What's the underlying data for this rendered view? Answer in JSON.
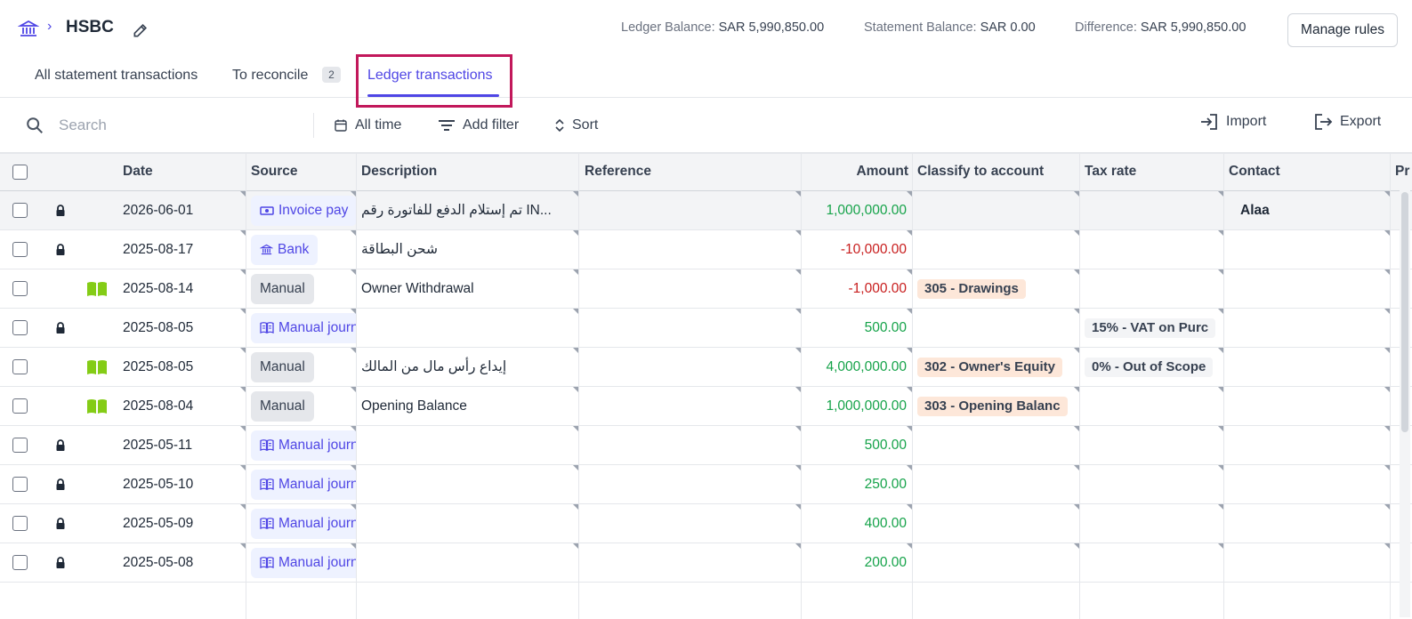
{
  "header": {
    "title": "HSBC",
    "breadcrumb_separator": "›",
    "ledger_balance_label": "Ledger Balance:",
    "ledger_balance_value": "SAR 5,990,850.00",
    "statement_balance_label": "Statement Balance:",
    "statement_balance_value": "SAR 0.00",
    "difference_label": "Difference:",
    "difference_value": "SAR 5,990,850.00",
    "manage_rules_label": "Manage rules"
  },
  "tabs": {
    "all": "All statement transactions",
    "to_reconcile": "To reconcile",
    "to_reconcile_count": "2",
    "ledger": "Ledger transactions",
    "active": "ledger"
  },
  "toolbar": {
    "search_placeholder": "Search",
    "all_time": "All time",
    "add_filter": "Add filter",
    "sort": "Sort",
    "import": "Import",
    "export": "Export"
  },
  "table": {
    "columns": [
      "Date",
      "Source",
      "Description",
      "Reference",
      "Amount",
      "Classify to account",
      "Tax rate",
      "Contact",
      "Pr"
    ],
    "rows": [
      {
        "icon": "lock",
        "date": "2026-06-01",
        "source": "Invoice pay",
        "source_style": "blue",
        "source_icon": "cash",
        "description": "تم إستلام الدفع للفاتورة رقم IN...",
        "reference": "",
        "amount": "1,000,000.00",
        "sign": "pos",
        "account": "",
        "tax": "",
        "contact": "Alaa"
      },
      {
        "icon": "lock",
        "date": "2025-08-17",
        "source": "Bank",
        "source_style": "blue",
        "source_icon": "bank",
        "description": "شحن البطاقة",
        "reference": "",
        "amount": "-10,000.00",
        "sign": "neg",
        "account": "",
        "tax": "",
        "contact": ""
      },
      {
        "icon": "book",
        "date": "2025-08-14",
        "source": "Manual",
        "source_style": "gray",
        "source_icon": "",
        "description": "Owner Withdrawal",
        "reference": "",
        "amount": "-1,000.00",
        "sign": "neg",
        "account": "305 - Drawings",
        "tax": "",
        "contact": ""
      },
      {
        "icon": "lock",
        "date": "2025-08-05",
        "source": "Manual journ",
        "source_style": "blue",
        "source_icon": "journal",
        "description": "",
        "reference": "",
        "amount": "500.00",
        "sign": "pos",
        "account": "",
        "tax": "15% - VAT on Purc",
        "contact": ""
      },
      {
        "icon": "book",
        "date": "2025-08-05",
        "source": "Manual",
        "source_style": "gray",
        "source_icon": "",
        "description": "إيداع رأس مال من المالك",
        "reference": "",
        "amount": "4,000,000.00",
        "sign": "pos",
        "account": "302 - Owner's Equity",
        "tax": "0% - Out of Scope",
        "contact": ""
      },
      {
        "icon": "book",
        "date": "2025-08-04",
        "source": "Manual",
        "source_style": "gray",
        "source_icon": "",
        "description": "Opening Balance",
        "reference": "",
        "amount": "1,000,000.00",
        "sign": "pos",
        "account": "303 - Opening Balanc",
        "tax": "",
        "contact": ""
      },
      {
        "icon": "lock",
        "date": "2025-05-11",
        "source": "Manual journ",
        "source_style": "blue",
        "source_icon": "journal",
        "description": "",
        "reference": "",
        "amount": "500.00",
        "sign": "pos",
        "account": "",
        "tax": "",
        "contact": ""
      },
      {
        "icon": "lock",
        "date": "2025-05-10",
        "source": "Manual journ",
        "source_style": "blue",
        "source_icon": "journal",
        "description": "",
        "reference": "",
        "amount": "250.00",
        "sign": "pos",
        "account": "",
        "tax": "",
        "contact": ""
      },
      {
        "icon": "lock",
        "date": "2025-05-09",
        "source": "Manual journ",
        "source_style": "blue",
        "source_icon": "journal",
        "description": "",
        "reference": "",
        "amount": "400.00",
        "sign": "pos",
        "account": "",
        "tax": "",
        "contact": ""
      },
      {
        "icon": "lock",
        "date": "2025-05-08",
        "source": "Manual journ",
        "source_style": "blue",
        "source_icon": "journal",
        "description": "",
        "reference": "",
        "amount": "200.00",
        "sign": "pos",
        "account": "",
        "tax": "",
        "contact": ""
      }
    ]
  },
  "colors": {
    "accent": "#4f46e5",
    "positive": "#16a34a",
    "negative": "#c81e1e",
    "highlight_box": "#c2185b",
    "manual_book_icon": "#84cc16"
  }
}
